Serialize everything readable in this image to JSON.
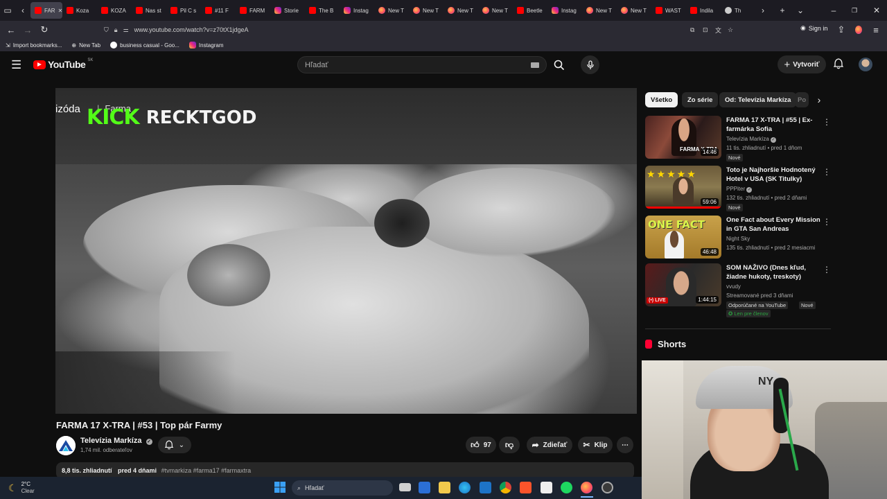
{
  "browser": {
    "tabs": [
      {
        "label": "FAR",
        "icon": "youtube-icon",
        "active": true
      },
      {
        "label": "Koza",
        "icon": "youtube-icon"
      },
      {
        "label": "KOZA",
        "icon": "youtube-icon"
      },
      {
        "label": "Nas st",
        "icon": "youtube-icon"
      },
      {
        "label": "Pil C s",
        "icon": "youtube-icon"
      },
      {
        "label": "#11 F",
        "icon": "youtube-icon"
      },
      {
        "label": "FARM",
        "icon": "youtube-icon"
      },
      {
        "label": "Storie",
        "icon": "instagram-icon"
      },
      {
        "label": "The B",
        "icon": "youtube-icon"
      },
      {
        "label": "Instag",
        "icon": "instagram-icon"
      },
      {
        "label": "New T",
        "icon": "firefox-icon"
      },
      {
        "label": "New T",
        "icon": "firefox-icon"
      },
      {
        "label": "New T",
        "icon": "firefox-icon"
      },
      {
        "label": "New T",
        "icon": "firefox-icon"
      },
      {
        "label": "Beetle",
        "icon": "youtube-icon"
      },
      {
        "label": "Instag",
        "icon": "instagram-icon"
      },
      {
        "label": "New T",
        "icon": "firefox-icon"
      },
      {
        "label": "New T",
        "icon": "firefox-icon"
      },
      {
        "label": "WAST",
        "icon": "youtube-icon"
      },
      {
        "label": "Indila",
        "icon": "youtube-icon"
      },
      {
        "label": "Th",
        "icon": "generic-icon"
      }
    ],
    "url": "www.youtube.com/watch?v=z70tX1jdgeA",
    "sign_in": "Sign in",
    "bookmarks": [
      {
        "label": "Import bookmarks...",
        "icon": "import-icon"
      },
      {
        "label": "New Tab",
        "icon": "globe-icon"
      },
      {
        "label": "business casual - Goo...",
        "icon": "google-icon"
      },
      {
        "label": "Instagram",
        "icon": "instagram-icon"
      }
    ]
  },
  "youtube": {
    "logo_text": "YouTube",
    "region": "SK",
    "search_placeholder": "Hľadať",
    "create_label": "Vytvoriť"
  },
  "video": {
    "overlay_episode": "izóda",
    "overlay_farma": "Farma",
    "kick_logo": "KICK",
    "kick_name": "RECKTGOD",
    "title": "FARMA 17 X-TRA | #53 | Top pár Farmy",
    "channel": "Televízia Markíza",
    "subscribers": "1,74 mil. odberateľov",
    "likes": "97",
    "share_label": "Zdieľať",
    "clip_label": "Klip",
    "views": "8,8 tis. zhliadnutí",
    "age": "pred 4 dňami",
    "hashtags": "#tvmarkiza #farma17 #farmaxtra"
  },
  "chips": [
    "Všetko",
    "Zo série",
    "Od: Televízia Markíza",
    "Po"
  ],
  "recommendations": [
    {
      "title": "FARMA 17 X-TRA | #55 | Ex-farmárka Sofia",
      "channel": "Televízia Markíza",
      "verified": true,
      "meta": "11 tis. zhliadnutí • pred 1 dňom",
      "badges": [
        "Nové"
      ],
      "duration": "14:46",
      "thumb_text": "FARMA X-TRA"
    },
    {
      "title": "Toto je Najhoršie Hodnotený Hotel v USA (SK Titulky)",
      "channel": "PPPiter",
      "verified": true,
      "meta": "132 tis. zhliadnutí • pred 2 dňami",
      "badges": [
        "Nové"
      ],
      "duration": "59:06",
      "thumb_text": ""
    },
    {
      "title": "One Fact about Every Mission in GTA San Andreas",
      "channel": "Night Sky",
      "verified": false,
      "meta": "135 tis. zhliadnutí • pred 2 mesiacmi",
      "badges": [],
      "duration": "46:48",
      "thumb_text": "ONE FACT"
    },
    {
      "title": "SOM NAŽIVO (Dnes kľud, žiadne hukoty, treskoty)",
      "channel": "vvudy",
      "verified": false,
      "meta": "Streamované pred 3 dňami",
      "badges": [
        "Odporúčané na YouTube",
        "Nové"
      ],
      "members": "Len pre členov",
      "duration": "1:44:15",
      "live_label": "LIVE",
      "thumb_text": ""
    }
  ],
  "shorts_label": "Shorts",
  "taskbar": {
    "weather_temp": "2°C",
    "weather_desc": "Clear",
    "search_placeholder": "Hľadať"
  },
  "colors": {
    "youtube_red": "#ff0000",
    "kick_green": "#53fc18",
    "background": "#0f0f0f"
  }
}
